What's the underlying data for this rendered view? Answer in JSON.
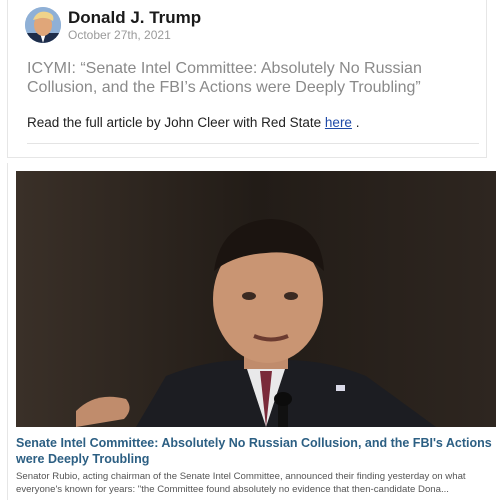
{
  "post": {
    "author": "Donald J. Trump",
    "date": "October 27th, 2021",
    "text": "ICYMI: “Senate Intel Committee: Absolutely No Russian Collusion, and the FBI’s Actions were Deeply Troubling”",
    "read_prefix": "Read the full article by John Cleer with Red State",
    "link_label": "here",
    "read_suffix": " ."
  },
  "link_preview": {
    "title_line1": "Senate Intel Committee: Absolutely No Russian Collusion, and the FBI's Actions",
    "title_line2": "were Deeply Troubling",
    "desc_line1": "Senator Rubio, acting chairman of the Senate Intel Committee, announced their finding yesterday on what",
    "desc_line2": "everyone's known for years: \"the Committee found absolutely no evidence that then-candidate Dona..."
  },
  "colors": {
    "link": "#1f4aa8",
    "preview_title": "#2c5f83"
  }
}
